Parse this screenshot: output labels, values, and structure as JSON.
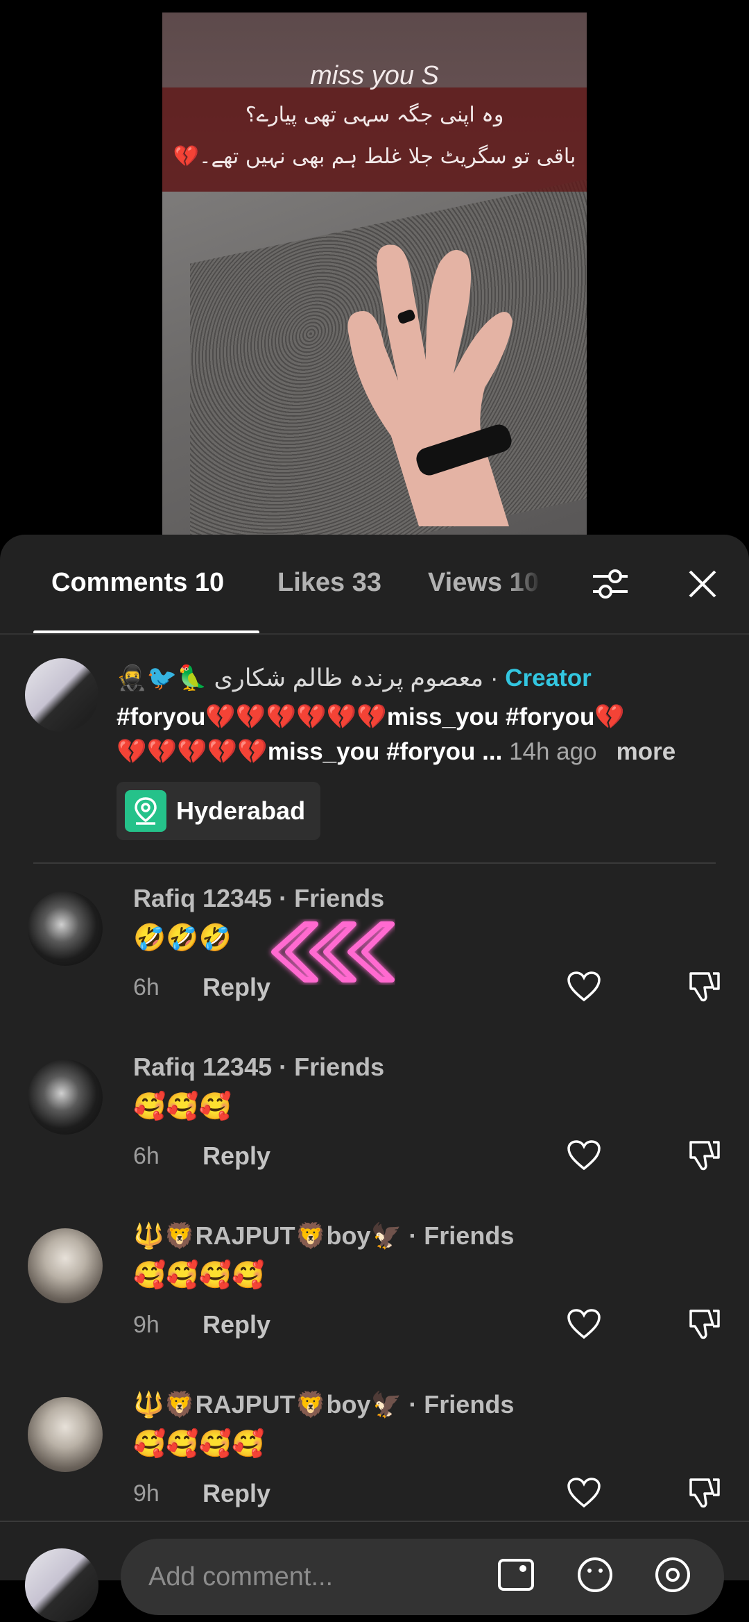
{
  "video": {
    "title": "miss you S",
    "urdu_line1": "وہ اپنی جگہ سہی تھی پیارے؟",
    "urdu_line2": "باقی تو سگریٹ جلا غلط ہم بھی نہیں تھے۔💔"
  },
  "tabs": {
    "comments": "Comments 10",
    "likes": "Likes 33",
    "views": "Views 10"
  },
  "post": {
    "author": "🥷🐦🦜 معصوم پرندہ ظالم شکاری",
    "separator": " · ",
    "creator_label": "Creator",
    "text_line1": "#foryou💔💔💔💔💔💔miss_you #foryou💔",
    "text_line2": "💔💔💔💔💔miss_you #foryou ... ",
    "time": "14h ago",
    "more": "more",
    "location": "Hyderabad"
  },
  "comments": [
    {
      "name": "Rafiq 12345 · Friends",
      "text": "🤣🤣🤣",
      "time": "6h",
      "reply": "Reply"
    },
    {
      "name": "Rafiq 12345 · Friends",
      "text": "🥰🥰🥰",
      "time": "6h",
      "reply": "Reply"
    },
    {
      "name": "🔱🦁RAJPUT🦁boy🦅 · Friends",
      "text": "🥰🥰🥰🥰",
      "time": "9h",
      "reply": "Reply"
    },
    {
      "name": "🔱🦁RAJPUT🦁boy🦅 · Friends",
      "text": "🥰🥰🥰🥰",
      "time": "9h",
      "reply": "Reply"
    }
  ],
  "input": {
    "placeholder": "Add comment..."
  },
  "colors": {
    "creator": "#33c6e0",
    "location_icon": "#25c28a",
    "sheet_bg": "#222222"
  }
}
